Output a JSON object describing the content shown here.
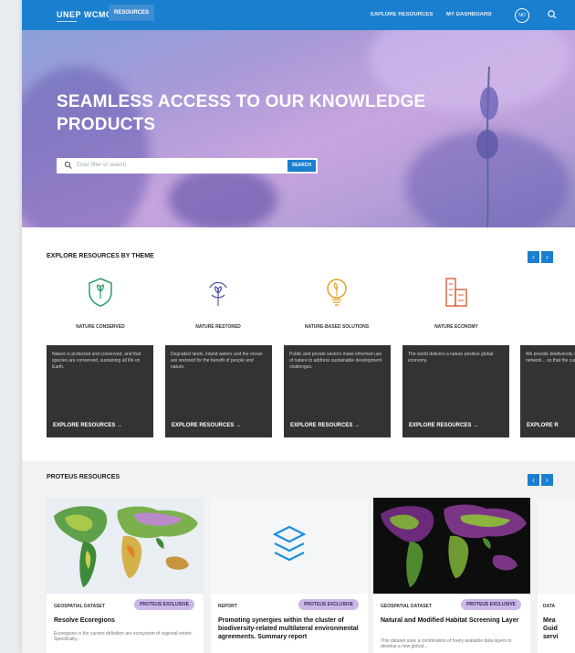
{
  "header": {
    "logo": "UNEP WCMC",
    "nav_tab": "RESOURCES",
    "nav_links": [
      "EXPLORE RESOURCES",
      "MY DASHBOARD"
    ],
    "avatar_initials": "NO",
    "accent_color": "#1b7fd0"
  },
  "hero": {
    "title": "SEAMLESS ACCESS TO OUR KNOWLEDGE PRODUCTS",
    "search_placeholder": "Enter filter or search",
    "search_button": "SEARCH"
  },
  "themes": {
    "section_title": "EXPLORE RESOURCES BY THEME",
    "items": [
      {
        "label": "NATURE CONSERVED",
        "icon": "shield-leaf-icon",
        "color": "#2a9d6b"
      },
      {
        "label": "NATURE RESTORED",
        "icon": "sprout-restore-icon",
        "color": "#5a5aa8"
      },
      {
        "label": "NATURE-BASED SOLUTIONS",
        "icon": "lightbulb-leaf-icon",
        "color": "#e0a020"
      },
      {
        "label": "NATURE ECONOMY",
        "icon": "building-blocks-icon",
        "color": "#d9623a"
      }
    ],
    "cards": [
      {
        "desc": "Nature is protected and conserved, and that species are conserved, sustaining all life on Earth.",
        "cta": "EXPLORE RESOURCES →"
      },
      {
        "desc": "Degraded lands, inland waters and the ocean are restored for the benefit of people and nature.",
        "cta": "EXPLORE RESOURCES →"
      },
      {
        "desc": "Public and private sectors make informed use of nature to address sustainable development challenges.",
        "cta": "EXPLORE RESOURCES →"
      },
      {
        "desc": "The world delivers a nature positive global economy.",
        "cta": "EXPLORE RESOURCES →"
      },
      {
        "desc": "We provide biodiversity services and reliable network... so that the current... are...",
        "cta": "EXPLORE R"
      }
    ]
  },
  "proteus": {
    "section_title": "PROTEUS RESOURCES",
    "cards": [
      {
        "type": "GEOSPATIAL DATASET",
        "badge": "PROTEUS EXCLUSIVE",
        "title": "Resolve Ecoregions",
        "desc": "Ecoregions in the current definition are ecosystem of regional extent. Specifically..."
      },
      {
        "type": "REPORT",
        "badge": "PROTEUS EXCLUSIVE",
        "title": "Promoting synergies within the cluster of biodiversity-related multilateral environmental agreements. Summary report",
        "desc": ""
      },
      {
        "type": "GEOSPATIAL DATASET",
        "badge": "PROTEUS EXCLUSIVE",
        "title": "Natural and Modified Habitat Screening Layer",
        "desc": "This dataset uses a combination of freely available data layers to develop a new global..."
      },
      {
        "type": "DATA",
        "badge": "",
        "title": "Mea Guid servi",
        "desc": ""
      }
    ]
  }
}
